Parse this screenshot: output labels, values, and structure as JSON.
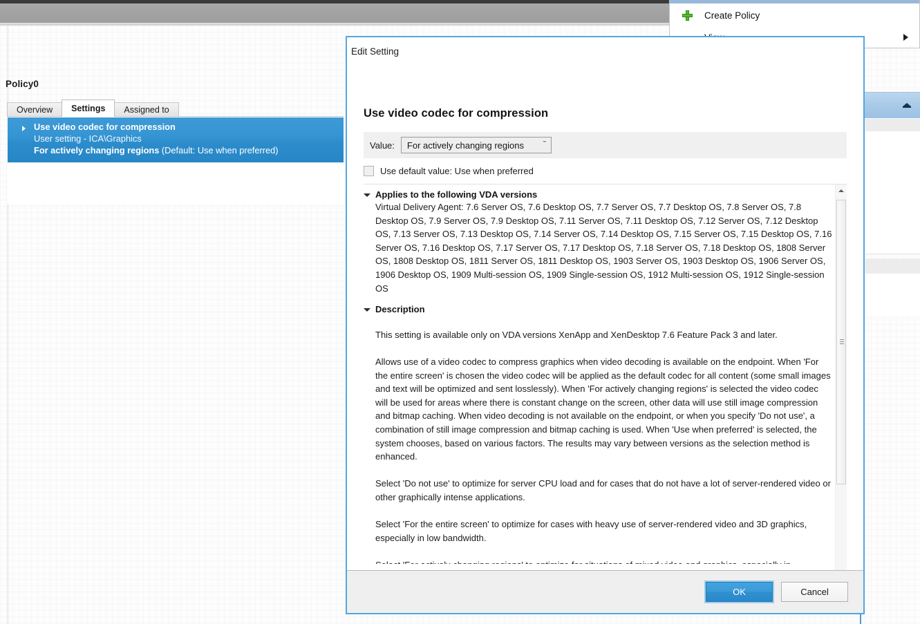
{
  "background": {
    "policy_pane": {
      "title": "Policy0",
      "tabs": [
        {
          "label": "Overview",
          "active": false
        },
        {
          "label": "Settings",
          "active": true
        },
        {
          "label": "Assigned to",
          "active": false
        }
      ],
      "selected_setting": {
        "name": "Use video codec for compression",
        "scope": "User setting - ICA\\Graphics",
        "value": "For actively changing regions",
        "default_note": "(Default: Use when preferred)"
      }
    },
    "context_menu": {
      "items": [
        {
          "label": "Create Policy",
          "icon": "green-plus-icon",
          "has_submenu": false
        },
        {
          "label": "View",
          "icon": "",
          "has_submenu": true
        }
      ]
    }
  },
  "dialog": {
    "title": "Edit Setting",
    "heading": "Use video codec for compression",
    "value_label": "Value:",
    "value_selected": "For actively changing regions",
    "value_chevron": "ˇ",
    "default_checkbox_label": "Use default value: Use when preferred",
    "default_checkbox_checked": false,
    "vda": {
      "header": "Applies to the following VDA versions",
      "body": "Virtual Delivery Agent: 7.6 Server OS, 7.6 Desktop OS, 7.7 Server OS, 7.7 Desktop OS, 7.8 Server OS, 7.8 Desktop OS, 7.9 Server OS, 7.9 Desktop OS, 7.11 Server OS, 7.11 Desktop OS, 7.12 Server OS, 7.12 Desktop OS, 7.13 Server OS, 7.13 Desktop OS, 7.14 Server OS, 7.14 Desktop OS, 7.15 Server OS, 7.15 Desktop OS, 7.16 Server OS, 7.16 Desktop OS, 7.17 Server OS, 7.17 Desktop OS, 7.18 Server OS, 7.18 Desktop OS, 1808 Server OS, 1808 Desktop OS, 1811 Server OS, 1811 Desktop OS, 1903 Server OS, 1903 Desktop OS, 1906 Server OS, 1906 Desktop OS, 1909 Multi-session OS, 1909 Single-session OS, 1912 Multi-session OS, 1912 Single-session OS"
    },
    "description": {
      "header": "Description",
      "paragraphs": [
        "This setting is available only on VDA versions XenApp and XenDesktop 7.6 Feature Pack 3 and later.",
        "Allows use of a video codec to compress graphics when video decoding is available on the endpoint. When 'For the entire screen' is chosen the video codec will be applied as the default codec for all content (some small images and text will be optimized and sent losslessly). When 'For actively changing regions' is selected the video codec will be used for areas where there is constant change on the screen, other data will use still image compression and bitmap caching. When video decoding is not available on the endpoint, or when you specify 'Do not use', a combination of still image compression and bitmap caching is used. When 'Use when preferred' is selected, the system chooses, based on various factors. The results may vary between versions as the selection method is enhanced.",
        "Select 'Do not use' to optimize for server CPU load and for cases that do not have a lot of server-rendered video or other graphically intense applications.",
        "Select 'For the entire screen' to optimize for cases with heavy use of server-rendered video and 3D graphics, especially in low bandwidth."
      ],
      "clipped_paragraph": "Select 'For actively changing regions' to optimize for situations of mixed video and graphics, especially in"
    },
    "buttons": {
      "ok": "OK",
      "cancel": "Cancel"
    }
  },
  "colors": {
    "accent_blue": "#3b9bd8",
    "dialog_border": "#55a6de",
    "selection_blue": "#2d8dcc",
    "plus_green": "#59b832"
  }
}
